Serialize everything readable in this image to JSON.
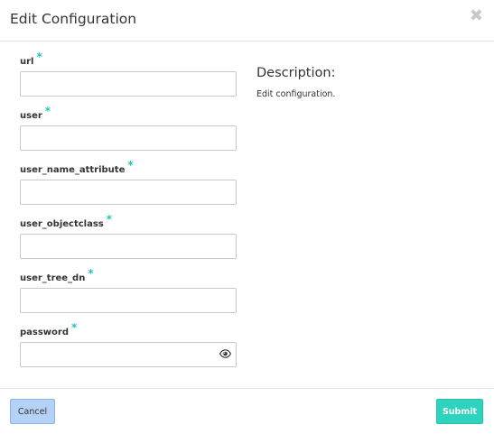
{
  "dialog": {
    "title": "Edit Configuration",
    "close_glyph": "✖"
  },
  "form": {
    "required_marker": "*",
    "fields": [
      {
        "label": "url",
        "value": ""
      },
      {
        "label": "user",
        "value": ""
      },
      {
        "label": "user_name_attribute",
        "value": ""
      },
      {
        "label": "user_objectclass",
        "value": ""
      },
      {
        "label": "user_tree_dn",
        "value": ""
      },
      {
        "label": "password",
        "value": "",
        "icon": "eye-icon"
      }
    ]
  },
  "description": {
    "title": "Description:",
    "text": "Edit configuration."
  },
  "footer": {
    "cancel_label": "Cancel",
    "submit_label": "Submit"
  },
  "colors": {
    "required": "#1fc8b4",
    "submit_bg": "#2ed3bd",
    "cancel_bg": "#b4d2f5"
  }
}
